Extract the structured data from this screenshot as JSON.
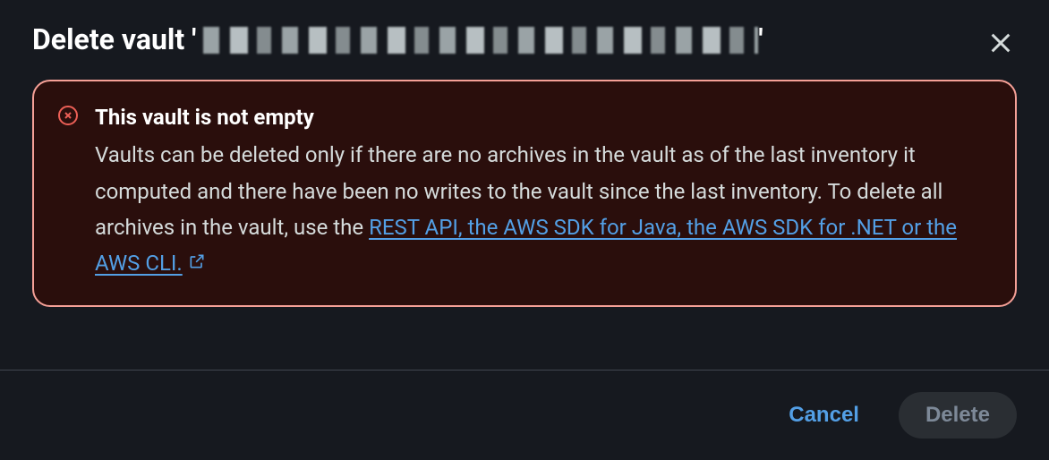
{
  "header": {
    "title_prefix": "Delete vault '",
    "title_suffix": "'"
  },
  "alert": {
    "title": "This vault is not empty",
    "body_before_link": "Vaults can be deleted only if there are no archives in the vault as of the last inventory it computed and there have been no writes to the vault since the last inventory. To delete all archives in the vault, use the ",
    "link_text": "REST API, the AWS SDK for Java, the AWS SDK for .NET or the AWS CLI."
  },
  "footer": {
    "cancel_label": "Cancel",
    "delete_label": "Delete"
  }
}
